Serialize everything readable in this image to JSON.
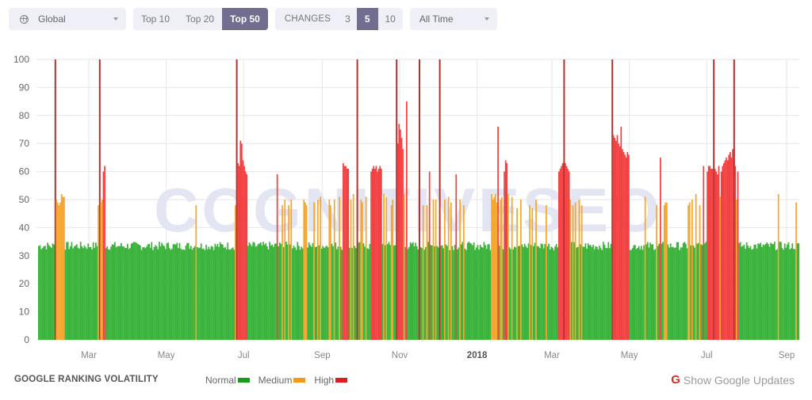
{
  "toolbar": {
    "region": {
      "icon": "globe-icon",
      "value": "Global"
    },
    "top_options": [
      {
        "label": "Top 10",
        "active": false
      },
      {
        "label": "Top 20",
        "active": false
      },
      {
        "label": "Top 50",
        "active": true
      }
    ],
    "changes": {
      "label": "CHANGES",
      "options": [
        {
          "label": "3",
          "active": false
        },
        {
          "label": "5",
          "active": true
        },
        {
          "label": "10",
          "active": false
        }
      ]
    },
    "period": {
      "value": "All Time"
    }
  },
  "colors": {
    "normal": "#3cb33c",
    "medium": "#f5a731",
    "high": "#f14343",
    "high_dark": "#b3322f",
    "grid": "#e6e6ec",
    "watermark": "#e3e5f2"
  },
  "watermark": "COGNITIVESEO",
  "footer": {
    "title": "GOOGLE RANKING VOLATILITY",
    "legend": [
      {
        "label": "Normal",
        "color": "#1a9a1a"
      },
      {
        "label": "Medium",
        "color": "#f59a17"
      },
      {
        "label": "High",
        "color": "#e01b1b"
      }
    ],
    "google_updates": {
      "icon": "google-g-icon",
      "icon_text": "G",
      "label": "Show Google Updates"
    }
  },
  "chart_data": {
    "type": "bar",
    "title": "Google Ranking Volatility",
    "xlabel": "",
    "ylabel": "",
    "ylim": [
      0,
      100
    ],
    "yticks": [
      0,
      10,
      20,
      30,
      40,
      50,
      60,
      70,
      80,
      90,
      100
    ],
    "grid": true,
    "start_date": "2017-01-20",
    "days": 600,
    "xticks": [
      {
        "label": "Mar",
        "day": 40,
        "bold": false
      },
      {
        "label": "May",
        "day": 101,
        "bold": false
      },
      {
        "label": "Jul",
        "day": 162,
        "bold": false
      },
      {
        "label": "Sep",
        "day": 224,
        "bold": false
      },
      {
        "label": "Nov",
        "day": 285,
        "bold": false
      },
      {
        "label": "2018",
        "day": 346,
        "bold": true
      },
      {
        "label": "Mar",
        "day": 405,
        "bold": false
      },
      {
        "label": "May",
        "day": 466,
        "bold": false
      },
      {
        "label": "Jul",
        "day": 527,
        "bold": false
      },
      {
        "label": "Sep",
        "day": 590,
        "bold": false
      }
    ],
    "thresholds": {
      "medium": 45,
      "high": 58
    },
    "baseline": {
      "min": 32,
      "max": 35
    },
    "segments": [
      {
        "day": 13,
        "values": [
          100
        ]
      },
      {
        "day": 14,
        "values": [
          50,
          49,
          48,
          49,
          52,
          51,
          51
        ]
      },
      {
        "day": 47,
        "values": [
          48,
          100,
          49,
          50,
          60,
          62
        ]
      },
      {
        "day": 124,
        "values": [
          48
        ]
      },
      {
        "day": 155,
        "values": [
          48,
          100,
          63,
          62,
          71,
          70,
          64,
          62,
          60,
          59
        ]
      },
      {
        "day": 188,
        "values": [
          59
        ]
      },
      {
        "day": 192,
        "values": [
          48
        ]
      },
      {
        "day": 194,
        "values": [
          50
        ]
      },
      {
        "day": 197,
        "values": [
          48
        ]
      },
      {
        "day": 199,
        "values": [
          50
        ]
      },
      {
        "day": 209,
        "values": [
          50,
          49,
          48
        ]
      },
      {
        "day": 217,
        "values": [
          49
        ]
      },
      {
        "day": 220,
        "values": [
          50
        ]
      },
      {
        "day": 222,
        "values": [
          51
        ]
      },
      {
        "day": 229,
        "values": [
          50,
          48
        ]
      },
      {
        "day": 233,
        "values": [
          50
        ]
      },
      {
        "day": 237,
        "values": [
          51
        ]
      },
      {
        "day": 240,
        "values": [
          63,
          62,
          62,
          61,
          61
        ]
      },
      {
        "day": 246,
        "values": [
          50
        ]
      },
      {
        "day": 248,
        "values": [
          52
        ]
      },
      {
        "day": 251,
        "values": [
          100
        ]
      },
      {
        "day": 254,
        "values": [
          50,
          49
        ]
      },
      {
        "day": 258,
        "values": [
          51
        ]
      },
      {
        "day": 262,
        "values": [
          60,
          61,
          62,
          61,
          62,
          60,
          61,
          62,
          61
        ]
      },
      {
        "day": 272,
        "values": [
          52
        ]
      },
      {
        "day": 274,
        "values": [
          51
        ]
      },
      {
        "day": 278,
        "values": [
          48,
          50
        ]
      },
      {
        "day": 282,
        "values": [
          100,
          70,
          77,
          75,
          72,
          68,
          52
        ]
      },
      {
        "day": 290,
        "values": [
          85
        ]
      },
      {
        "day": 300,
        "values": [
          100
        ]
      },
      {
        "day": 303,
        "values": [
          48
        ]
      },
      {
        "day": 306,
        "values": [
          48
        ]
      },
      {
        "day": 308,
        "values": [
          60
        ]
      },
      {
        "day": 311,
        "values": [
          50
        ]
      },
      {
        "day": 313,
        "values": [
          50
        ]
      },
      {
        "day": 316,
        "values": [
          100
        ]
      },
      {
        "day": 320,
        "values": [
          50
        ]
      },
      {
        "day": 323,
        "values": [
          51
        ]
      },
      {
        "day": 325,
        "values": [
          49
        ]
      },
      {
        "day": 329,
        "values": [
          59
        ]
      },
      {
        "day": 332,
        "values": [
          50
        ]
      },
      {
        "day": 335,
        "values": [
          48
        ]
      },
      {
        "day": 357,
        "values": [
          52,
          50,
          51,
          52,
          49
        ]
      },
      {
        "day": 362,
        "values": [
          76
        ]
      },
      {
        "day": 364,
        "values": [
          50,
          51
        ]
      },
      {
        "day": 367,
        "values": [
          60,
          64,
          63,
          52
        ]
      },
      {
        "day": 373,
        "values": [
          51
        ]
      },
      {
        "day": 377,
        "values": [
          47
        ]
      },
      {
        "day": 380,
        "values": [
          50
        ]
      },
      {
        "day": 387,
        "values": [
          48
        ]
      },
      {
        "day": 389,
        "values": [
          47
        ]
      },
      {
        "day": 392,
        "values": [
          50
        ]
      },
      {
        "day": 400,
        "values": [
          48
        ]
      },
      {
        "day": 410,
        "values": [
          60,
          61,
          62,
          63,
          100,
          63,
          62,
          61,
          60,
          50
        ]
      },
      {
        "day": 421,
        "values": [
          48
        ]
      },
      {
        "day": 423,
        "values": [
          49
        ]
      },
      {
        "day": 426,
        "values": [
          50
        ]
      },
      {
        "day": 428,
        "values": [
          48
        ]
      },
      {
        "day": 452,
        "values": [
          100,
          73,
          72,
          71,
          73,
          70,
          69,
          76,
          68,
          67,
          66,
          65,
          67,
          66
        ]
      },
      {
        "day": 478,
        "values": [
          51
        ]
      },
      {
        "day": 487,
        "values": [
          48
        ]
      },
      {
        "day": 490,
        "values": [
          65
        ]
      },
      {
        "day": 493,
        "values": [
          48,
          49
        ]
      },
      {
        "day": 495,
        "values": [
          49
        ]
      },
      {
        "day": 512,
        "values": [
          48,
          49
        ]
      },
      {
        "day": 515,
        "values": [
          50
        ]
      },
      {
        "day": 518,
        "values": [
          52
        ]
      },
      {
        "day": 521,
        "values": [
          48
        ]
      },
      {
        "day": 524,
        "values": [
          62
        ]
      },
      {
        "day": 527,
        "values": [
          60,
          62,
          62,
          61,
          61,
          100,
          61,
          60,
          59,
          62,
          51,
          60,
          62,
          63,
          64,
          65,
          64,
          66,
          67,
          65,
          68,
          100,
          62,
          50,
          60
        ]
      },
      {
        "day": 583,
        "values": [
          52
        ]
      },
      {
        "day": 597,
        "values": [
          49
        ]
      }
    ]
  }
}
